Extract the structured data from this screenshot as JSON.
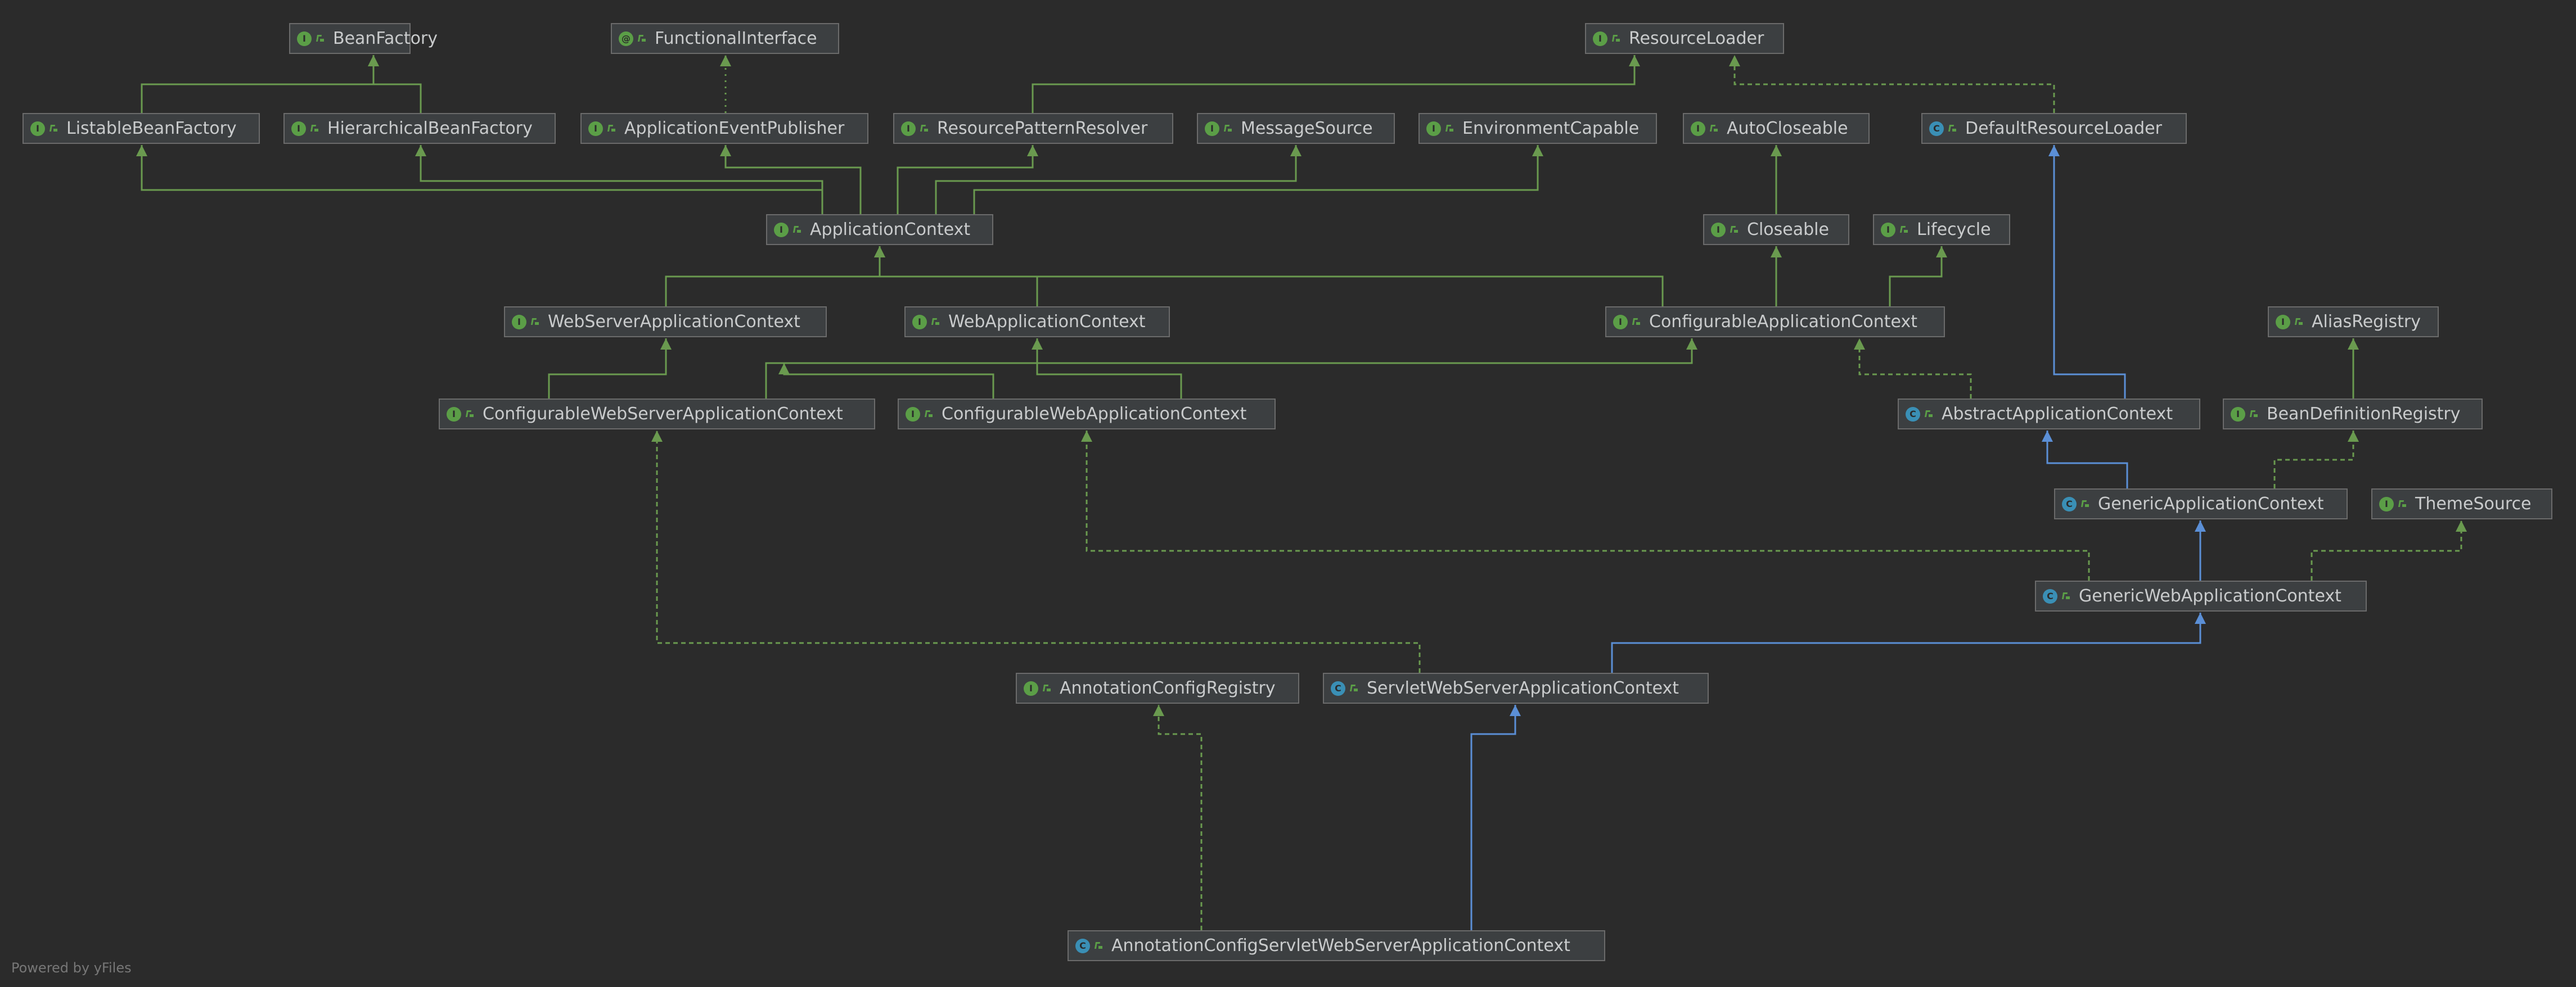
{
  "footer": "Powered by yFiles",
  "colors": {
    "background": "#2b2b2b",
    "node_fill": "#3c3f41",
    "node_border": "#6b6b6b",
    "text": "#c9cbcc",
    "interface_badge": "#5b9e47",
    "class_badge": "#3a8fb5",
    "extends_edge": "#6a9a4f",
    "implements_edge": "#6a9a4f",
    "class_inheritance_edge": "#5b8fd6"
  },
  "nodes": {
    "BeanFactory": {
      "label": "BeanFactory",
      "kind": "interface",
      "badge": "I"
    },
    "FunctionalInterface": {
      "label": "FunctionalInterface",
      "kind": "annotation",
      "badge": "@"
    },
    "ResourceLoader": {
      "label": "ResourceLoader",
      "kind": "interface",
      "badge": "I"
    },
    "ListableBeanFactory": {
      "label": "ListableBeanFactory",
      "kind": "interface",
      "badge": "I"
    },
    "HierarchicalBeanFactory": {
      "label": "HierarchicalBeanFactory",
      "kind": "interface",
      "badge": "I"
    },
    "ApplicationEventPublisher": {
      "label": "ApplicationEventPublisher",
      "kind": "interface",
      "badge": "I"
    },
    "ResourcePatternResolver": {
      "label": "ResourcePatternResolver",
      "kind": "interface",
      "badge": "I"
    },
    "MessageSource": {
      "label": "MessageSource",
      "kind": "interface",
      "badge": "I"
    },
    "EnvironmentCapable": {
      "label": "EnvironmentCapable",
      "kind": "interface",
      "badge": "I"
    },
    "AutoCloseable": {
      "label": "AutoCloseable",
      "kind": "interface",
      "badge": "I"
    },
    "DefaultResourceLoader": {
      "label": "DefaultResourceLoader",
      "kind": "class",
      "badge": "C"
    },
    "ApplicationContext": {
      "label": "ApplicationContext",
      "kind": "interface",
      "badge": "I"
    },
    "Closeable": {
      "label": "Closeable",
      "kind": "interface",
      "badge": "I"
    },
    "Lifecycle": {
      "label": "Lifecycle",
      "kind": "interface",
      "badge": "I"
    },
    "WebServerApplicationContext": {
      "label": "WebServerApplicationContext",
      "kind": "interface",
      "badge": "I"
    },
    "WebApplicationContext": {
      "label": "WebApplicationContext",
      "kind": "interface",
      "badge": "I"
    },
    "ConfigurableApplicationContext": {
      "label": "ConfigurableApplicationContext",
      "kind": "interface",
      "badge": "I"
    },
    "AliasRegistry": {
      "label": "AliasRegistry",
      "kind": "interface",
      "badge": "I"
    },
    "ConfigurableWebServerApplicationContext": {
      "label": "ConfigurableWebServerApplicationContext",
      "kind": "interface",
      "badge": "I"
    },
    "ConfigurableWebApplicationContext": {
      "label": "ConfigurableWebApplicationContext",
      "kind": "interface",
      "badge": "I"
    },
    "AbstractApplicationContext": {
      "label": "AbstractApplicationContext",
      "kind": "class",
      "badge": "C"
    },
    "BeanDefinitionRegistry": {
      "label": "BeanDefinitionRegistry",
      "kind": "interface",
      "badge": "I"
    },
    "GenericApplicationContext": {
      "label": "GenericApplicationContext",
      "kind": "class",
      "badge": "C"
    },
    "ThemeSource": {
      "label": "ThemeSource",
      "kind": "interface",
      "badge": "I"
    },
    "GenericWebApplicationContext": {
      "label": "GenericWebApplicationContext",
      "kind": "class",
      "badge": "C"
    },
    "AnnotationConfigRegistry": {
      "label": "AnnotationConfigRegistry",
      "kind": "interface",
      "badge": "I"
    },
    "ServletWebServerApplicationContext": {
      "label": "ServletWebServerApplicationContext",
      "kind": "class",
      "badge": "C"
    },
    "AnnotationConfigServletWebServerApplicationContext": {
      "label": "AnnotationConfigServletWebServerApplicationContext",
      "kind": "class",
      "badge": "C"
    }
  },
  "edges": [
    {
      "from": "ListableBeanFactory",
      "to": "BeanFactory",
      "type": "extends"
    },
    {
      "from": "HierarchicalBeanFactory",
      "to": "BeanFactory",
      "type": "extends"
    },
    {
      "from": "ApplicationEventPublisher",
      "to": "FunctionalInterface",
      "type": "annotated"
    },
    {
      "from": "ResourcePatternResolver",
      "to": "ResourceLoader",
      "type": "extends"
    },
    {
      "from": "DefaultResourceLoader",
      "to": "ResourceLoader",
      "type": "implements"
    },
    {
      "from": "ApplicationContext",
      "to": "ListableBeanFactory",
      "type": "extends"
    },
    {
      "from": "ApplicationContext",
      "to": "HierarchicalBeanFactory",
      "type": "extends"
    },
    {
      "from": "ApplicationContext",
      "to": "ApplicationEventPublisher",
      "type": "extends"
    },
    {
      "from": "ApplicationContext",
      "to": "ResourcePatternResolver",
      "type": "extends"
    },
    {
      "from": "ApplicationContext",
      "to": "MessageSource",
      "type": "extends"
    },
    {
      "from": "ApplicationContext",
      "to": "EnvironmentCapable",
      "type": "extends"
    },
    {
      "from": "Closeable",
      "to": "AutoCloseable",
      "type": "extends"
    },
    {
      "from": "WebServerApplicationContext",
      "to": "ApplicationContext",
      "type": "extends"
    },
    {
      "from": "WebApplicationContext",
      "to": "ApplicationContext",
      "type": "extends"
    },
    {
      "from": "ConfigurableApplicationContext",
      "to": "ApplicationContext",
      "type": "extends"
    },
    {
      "from": "ConfigurableApplicationContext",
      "to": "Closeable",
      "type": "extends"
    },
    {
      "from": "ConfigurableApplicationContext",
      "to": "Lifecycle",
      "type": "extends"
    },
    {
      "from": "ConfigurableWebServerApplicationContext",
      "to": "WebServerApplicationContext",
      "type": "extends"
    },
    {
      "from": "ConfigurableWebServerApplicationContext",
      "to": "ConfigurableApplicationContext",
      "type": "extends"
    },
    {
      "from": "ConfigurableWebApplicationContext",
      "to": "WebApplicationContext",
      "type": "extends"
    },
    {
      "from": "ConfigurableWebApplicationContext",
      "to": "ConfigurableApplicationContext",
      "type": "extends"
    },
    {
      "from": "AbstractApplicationContext",
      "to": "ConfigurableApplicationContext",
      "type": "implements"
    },
    {
      "from": "AbstractApplicationContext",
      "to": "DefaultResourceLoader",
      "type": "class_extends"
    },
    {
      "from": "BeanDefinitionRegistry",
      "to": "AliasRegistry",
      "type": "extends"
    },
    {
      "from": "GenericApplicationContext",
      "to": "AbstractApplicationContext",
      "type": "class_extends"
    },
    {
      "from": "GenericApplicationContext",
      "to": "BeanDefinitionRegistry",
      "type": "implements"
    },
    {
      "from": "GenericWebApplicationContext",
      "to": "GenericApplicationContext",
      "type": "class_extends"
    },
    {
      "from": "GenericWebApplicationContext",
      "to": "ConfigurableWebApplicationContext",
      "type": "implements"
    },
    {
      "from": "GenericWebApplicationContext",
      "to": "ThemeSource",
      "type": "implements"
    },
    {
      "from": "ServletWebServerApplicationContext",
      "to": "GenericWebApplicationContext",
      "type": "class_extends"
    },
    {
      "from": "ServletWebServerApplicationContext",
      "to": "ConfigurableWebServerApplicationContext",
      "type": "implements"
    },
    {
      "from": "AnnotationConfigServletWebServerApplicationContext",
      "to": "ServletWebServerApplicationContext",
      "type": "class_extends"
    },
    {
      "from": "AnnotationConfigServletWebServerApplicationContext",
      "to": "AnnotationConfigRegistry",
      "type": "implements"
    }
  ]
}
